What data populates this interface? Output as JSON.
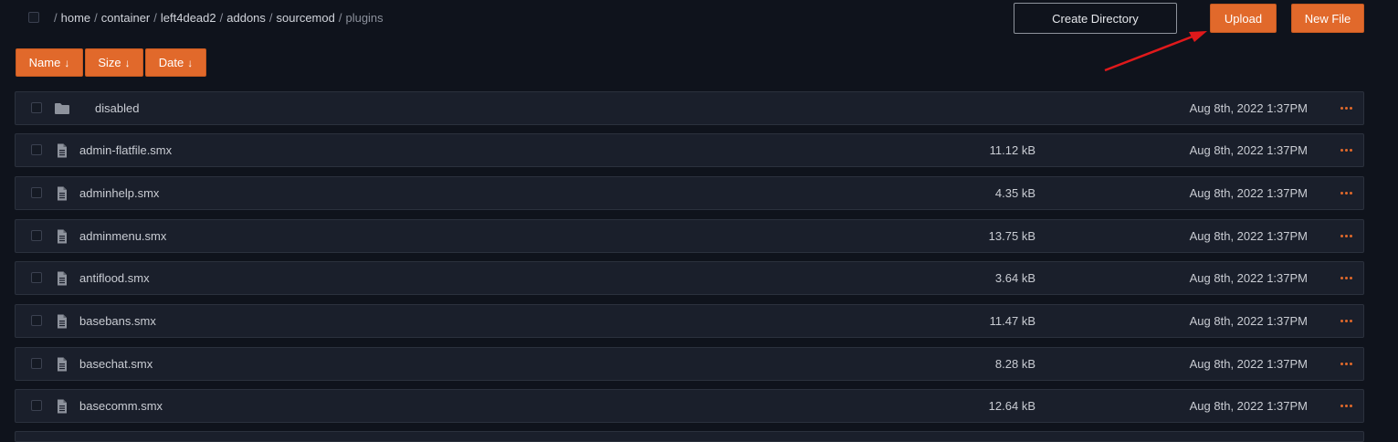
{
  "breadcrumb": {
    "lead_sep": "/",
    "segments": [
      "home",
      "container",
      "left4dead2",
      "addons",
      "sourcemod"
    ],
    "current": "plugins",
    "separator": "/"
  },
  "toolbar": {
    "create_directory_label": "Create Directory",
    "upload_label": "Upload",
    "new_file_label": "New File"
  },
  "sort": {
    "name_label": "Name",
    "size_label": "Size",
    "date_label": "Date",
    "arrow": "↓"
  },
  "colors": {
    "background": "#0f131c",
    "row_background": "#1a1f2b",
    "accent": "#e1692b",
    "annotation_arrow": "#e0191b"
  },
  "files": [
    {
      "type": "folder",
      "icon": "folder-icon",
      "name": "disabled",
      "size": "",
      "date": "Aug 8th, 2022 1:37PM"
    },
    {
      "type": "file",
      "icon": "file-icon",
      "name": "admin-flatfile.smx",
      "size": "11.12 kB",
      "date": "Aug 8th, 2022 1:37PM"
    },
    {
      "type": "file",
      "icon": "file-icon",
      "name": "adminhelp.smx",
      "size": "4.35 kB",
      "date": "Aug 8th, 2022 1:37PM"
    },
    {
      "type": "file",
      "icon": "file-icon",
      "name": "adminmenu.smx",
      "size": "13.75 kB",
      "date": "Aug 8th, 2022 1:37PM"
    },
    {
      "type": "file",
      "icon": "file-icon",
      "name": "antiflood.smx",
      "size": "3.64 kB",
      "date": "Aug 8th, 2022 1:37PM"
    },
    {
      "type": "file",
      "icon": "file-icon",
      "name": "basebans.smx",
      "size": "11.47 kB",
      "date": "Aug 8th, 2022 1:37PM"
    },
    {
      "type": "file",
      "icon": "file-icon",
      "name": "basechat.smx",
      "size": "8.28 kB",
      "date": "Aug 8th, 2022 1:37PM"
    },
    {
      "type": "file",
      "icon": "file-icon",
      "name": "basecomm.smx",
      "size": "12.64 kB",
      "date": "Aug 8th, 2022 1:37PM"
    }
  ]
}
